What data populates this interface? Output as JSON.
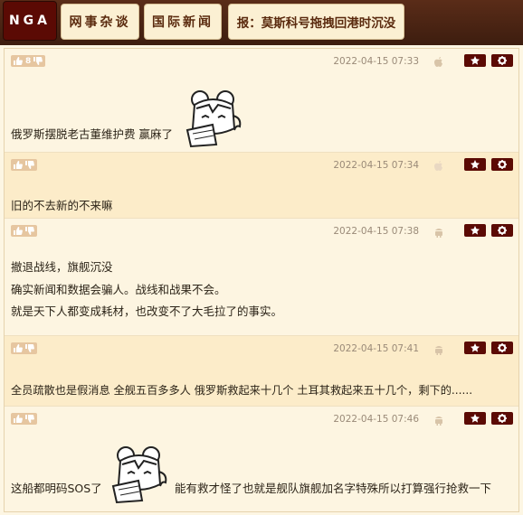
{
  "nav": {
    "logo": "NGA",
    "crumbs": [
      "网事杂谈",
      "国际新闻",
      "报：莫斯科号拖拽回港时沉没"
    ]
  },
  "posts": [
    {
      "votes": "8",
      "date": "2022-04-15 07:33",
      "device": "apple-icon",
      "lines": [
        "俄罗斯摆脱老古董维护费 赢麻了"
      ],
      "has_sticker": true
    },
    {
      "votes": "",
      "date": "2022-04-15 07:34",
      "device": "apple-icon",
      "lines": [
        "旧的不去新的不来嘛"
      ],
      "has_sticker": false
    },
    {
      "votes": "",
      "date": "2022-04-15 07:38",
      "device": "android-icon",
      "lines": [
        "撤退战线，旗舰沉没",
        "确实新闻和数据会骗人。战线和战果不会。",
        "就是天下人都变成耗材，也改变不了大毛拉了的事实。"
      ],
      "has_sticker": false
    },
    {
      "votes": "",
      "date": "2022-04-15 07:41",
      "device": "android-icon",
      "lines": [
        "全员疏散也是假消息 全舰五百多多人 俄罗斯救起来十几个 土耳其救起来五十几个，剩下的......"
      ],
      "has_sticker": false
    },
    {
      "votes": "",
      "date": "2022-04-15 07:46",
      "device": "android-icon",
      "lines": [
        "这船都明码SOS了",
        "能有救才怪了也就是舰队旗舰加名字特殊所以打算强行抢救一下"
      ],
      "has_sticker": true
    }
  ],
  "colors": {
    "header_bg": "#3d1d0f",
    "logo_bg": "#5b0a04",
    "crumb_bg": "#fbf0d3",
    "post_bg_odd": "#fdf5e1",
    "post_bg_even": "#fcecc9",
    "action_btn": "#5b0a04"
  }
}
